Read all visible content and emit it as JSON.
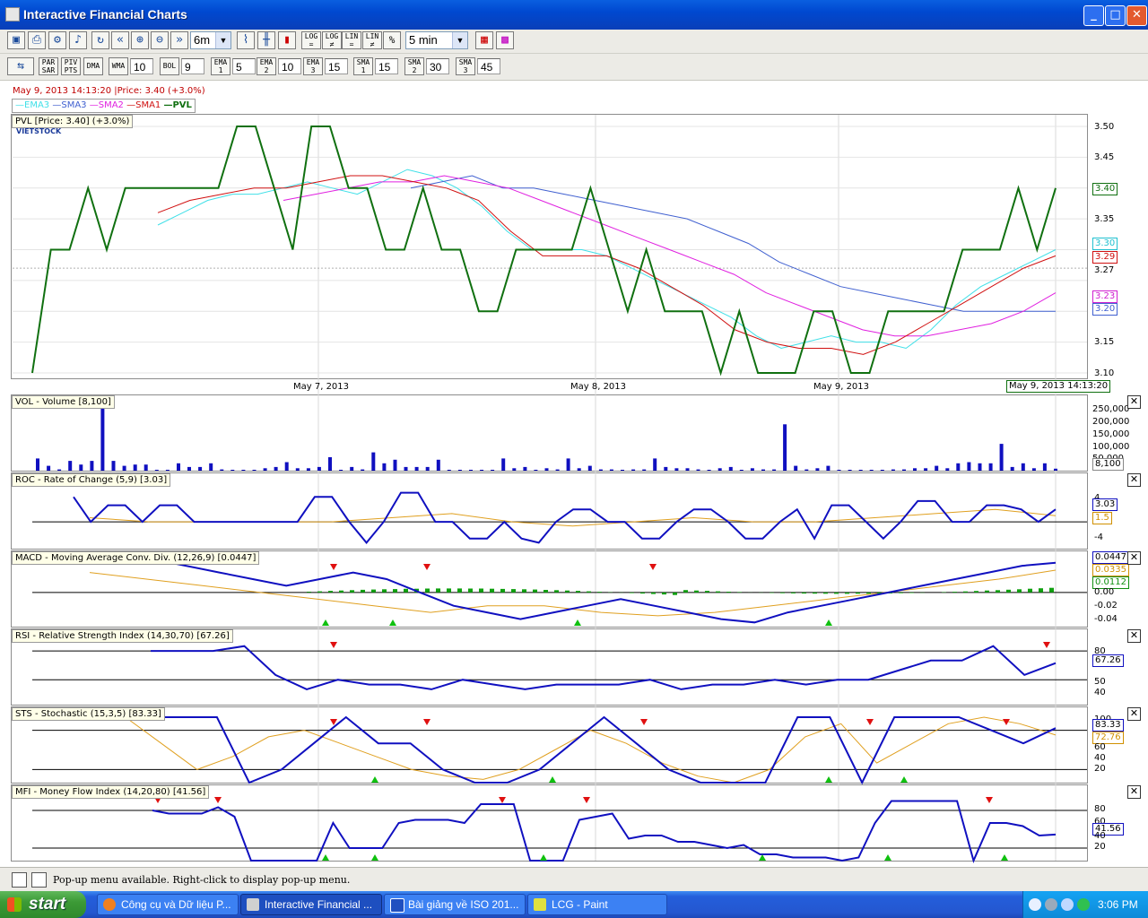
{
  "window": {
    "title": "Interactive Financial Charts"
  },
  "toolbar1": {
    "period_value": "6m",
    "log_buttons": [
      "LOG =",
      "LOG ≠",
      "LIN =",
      "LIN ≠",
      "%"
    ],
    "interval_value": "5 min"
  },
  "toolbar2": {
    "buttons": [
      "PAR SAR",
      "PIV PTS",
      "DMA"
    ],
    "wma_label": "WMA",
    "wma_value": "10",
    "bol_label": "BOL",
    "bol_value": "9",
    "ema1_label": "EMA 1",
    "ema1_value": "5",
    "ema2_label": "EMA 2",
    "ema2_value": "10",
    "ema3_label": "EMA 3",
    "ema3_value": "15",
    "sma1_label": "SMA 1",
    "sma1_value": "15",
    "sma2_label": "SMA 2",
    "sma2_value": "30",
    "sma3_label": "SMA 3",
    "sma3_value": "45"
  },
  "chart_header": {
    "status": "May 9, 2013 14:13:20 |Price: 3.40 (+3.0%)",
    "legend": [
      {
        "label": "EMA3",
        "color": "#40e0e8"
      },
      {
        "label": "SMA3",
        "color": "#4060d0"
      },
      {
        "label": "SMA2",
        "color": "#e020e0"
      },
      {
        "label": "SMA1",
        "color": "#d01010"
      },
      {
        "label": "PVL",
        "color": "#107010"
      }
    ]
  },
  "price_panel": {
    "label": "PVL [Price: 3.40] (+3.0%)",
    "logo_text": "VIETSTOCK",
    "date_labels": [
      "May 7, 2013",
      "May 8, 2013",
      "May 9, 2013"
    ],
    "cursor_date": "May 9, 2013 14:13:20",
    "y_ticks": [
      "3.50",
      "3.45",
      "3.40",
      "3.35",
      "3.30",
      "3.29",
      "3.27",
      "3.23",
      "3.20",
      "3.15",
      "3.10"
    ],
    "value_boxes": [
      {
        "text": "3.40",
        "color": "#107010"
      },
      {
        "text": "3.30",
        "color": "#20c0d0"
      },
      {
        "text": "3.29",
        "color": "#d01010"
      },
      {
        "text": "3.23",
        "color": "#d020d0"
      },
      {
        "text": "3.20",
        "color": "#4060d0"
      }
    ]
  },
  "volume_panel": {
    "label": "VOL - Volume [8,100]",
    "y_ticks": [
      "250,000",
      "200,000",
      "150,000",
      "100,000",
      "50,000"
    ],
    "current": "8,100"
  },
  "roc_panel": {
    "label": "ROC - Rate of Change (5,9) [3.03]",
    "y_ticks": [
      "4",
      "-4"
    ],
    "current": "3.03",
    "signal": "1.5"
  },
  "macd_panel": {
    "label": "MACD - Moving Average Conv. Div. (12,26,9) [0.0447]",
    "y_ticks": [
      "0.00",
      "-0.02",
      "-0.04"
    ],
    "current": "0.0447",
    "signal": "0.0335",
    "hist": "0.0112"
  },
  "rsi_panel": {
    "label": "RSI - Relative Strength Index (14,30,70) [67.26]",
    "y_ticks": [
      "80",
      "50",
      "40"
    ],
    "current": "67.26"
  },
  "sts_panel": {
    "label": "STS - Stochastic (15,3,5) [83.33]",
    "y_ticks": [
      "100",
      "60",
      "40",
      "20"
    ],
    "current": "83.33",
    "signal": "72.76"
  },
  "mfi_panel": {
    "label": "MFI - Money Flow Index (14,20,80) [41.56]",
    "y_ticks": [
      "80",
      "60",
      "40",
      "20"
    ],
    "current": "41.56"
  },
  "statusbar": {
    "message": "Pop-up menu available. Right-click to display pop-up menu."
  },
  "taskbar": {
    "start": "start",
    "tasks": [
      {
        "label": "Công cụ và Dữ liệu P...",
        "color": "#f08020"
      },
      {
        "label": "Interactive Financial ...",
        "color": "#d0d0d0"
      },
      {
        "label": "Bài giảng về ISO 201...",
        "color": "#2050c0"
      },
      {
        "label": "LCG - Paint",
        "color": "#e0e040"
      }
    ],
    "clock": "3:06 PM"
  },
  "chart_data": [
    {
      "type": "line",
      "title": "PVL [Price: 3.40] (+3.0%)",
      "ylim": [
        3.1,
        3.5
      ],
      "x": [
        "May 7, 2013",
        "May 8, 2013",
        "May 9, 2013"
      ],
      "series": [
        {
          "name": "PVL",
          "values": [
            3.1,
            3.3,
            3.3,
            3.4,
            3.3,
            3.4,
            3.4,
            3.4,
            3.4,
            3.4,
            3.4,
            3.5,
            3.5,
            3.4,
            3.3,
            3.5,
            3.5,
            3.4,
            3.4,
            3.3,
            3.3,
            3.4,
            3.3,
            3.3,
            3.2,
            3.2,
            3.3,
            3.3,
            3.3,
            3.3,
            3.4,
            3.3,
            3.2,
            3.3,
            3.2,
            3.2,
            3.2,
            3.1,
            3.2,
            3.1,
            3.1,
            3.1,
            3.2,
            3.2,
            3.1,
            3.1,
            3.2,
            3.2,
            3.2,
            3.2,
            3.3,
            3.3,
            3.3,
            3.4,
            3.3,
            3.4
          ]
        },
        {
          "name": "EMA3",
          "values": [
            3.34,
            3.36,
            3.38,
            3.39,
            3.39,
            3.4,
            3.41,
            3.4,
            3.39,
            3.41,
            3.43,
            3.42,
            3.4,
            3.37,
            3.33,
            3.3,
            3.3,
            3.3,
            3.29,
            3.27,
            3.25,
            3.23,
            3.21,
            3.19,
            3.16,
            3.14,
            3.15,
            3.16,
            3.15,
            3.15,
            3.14,
            3.17,
            3.21,
            3.24,
            3.26,
            3.28,
            3.3
          ]
        },
        {
          "name": "SMA3",
          "values": [
            3.4,
            3.41,
            3.42,
            3.4,
            3.4,
            3.39,
            3.38,
            3.37,
            3.36,
            3.35,
            3.33,
            3.31,
            3.28,
            3.26,
            3.24,
            3.23,
            3.22,
            3.21,
            3.2,
            3.2,
            3.2,
            3.2
          ]
        },
        {
          "name": "SMA2",
          "values": [
            3.38,
            3.39,
            3.4,
            3.41,
            3.41,
            3.42,
            3.41,
            3.4,
            3.38,
            3.36,
            3.34,
            3.32,
            3.3,
            3.28,
            3.26,
            3.23,
            3.21,
            3.19,
            3.17,
            3.16,
            3.16,
            3.17,
            3.18,
            3.2,
            3.23
          ]
        },
        {
          "name": "SMA1",
          "values": [
            3.36,
            3.38,
            3.39,
            3.4,
            3.4,
            3.41,
            3.42,
            3.42,
            3.41,
            3.4,
            3.38,
            3.33,
            3.29,
            3.29,
            3.29,
            3.27,
            3.24,
            3.21,
            3.17,
            3.15,
            3.14,
            3.14,
            3.13,
            3.15,
            3.18,
            3.21,
            3.24,
            3.27,
            3.29
          ]
        }
      ]
    },
    {
      "type": "bar",
      "title": "VOL - Volume [8,100]",
      "ylim": [
        0,
        250000
      ],
      "series": [
        {
          "name": "Volume",
          "values": [
            50000,
            20000,
            5000,
            40000,
            25000,
            40000,
            260000,
            40000,
            20000,
            25000,
            25000,
            3000,
            3000,
            30000,
            15000,
            15000,
            30000,
            5000,
            3000,
            3000,
            3000,
            10000,
            15000,
            35000,
            10000,
            10000,
            15000,
            55000,
            3000,
            15000,
            5000,
            75000,
            30000,
            45000,
            15000,
            15000,
            15000,
            45000,
            3000,
            3000,
            3000,
            3000,
            3000,
            50000,
            10000,
            15000,
            3000,
            10000,
            5000,
            50000,
            10000,
            20000,
            5000,
            5000,
            3000,
            5000,
            5000,
            50000,
            15000,
            10000,
            10000,
            5000,
            3000,
            10000,
            15000,
            3000,
            10000,
            5000,
            5000,
            190000,
            20000,
            5000,
            10000,
            20000,
            3000,
            3000,
            3000,
            3000,
            3000,
            5000,
            5000,
            10000,
            10000,
            20000,
            10000,
            30000,
            35000,
            30000,
            30000,
            110000,
            15000,
            30000,
            10000,
            30000,
            8100
          ]
        }
      ]
    },
    {
      "type": "line",
      "title": "ROC - Rate of Change (5,9) [3.03]",
      "series": [
        {
          "name": "ROC",
          "values": [
            6,
            0,
            4,
            4,
            0,
            4,
            4,
            0,
            0,
            0,
            0,
            0,
            0,
            0,
            6,
            6,
            0,
            -5,
            0,
            7,
            7,
            0,
            0,
            -4,
            -4,
            0,
            -4,
            -5,
            0,
            3,
            3,
            0,
            0,
            -4,
            -4,
            0,
            3,
            3,
            0,
            -4,
            -4,
            0,
            3,
            -4,
            4,
            4,
            0,
            -4,
            0,
            5,
            5,
            0,
            0,
            4,
            4,
            3,
            0,
            3
          ]
        },
        {
          "name": "Signal",
          "values": [
            1,
            0,
            0,
            0,
            0,
            1,
            2,
            0,
            -1,
            0,
            1,
            0,
            0,
            1,
            2,
            3,
            1.5
          ]
        }
      ]
    },
    {
      "type": "line",
      "title": "MACD - Moving Average Conv. Div. (12,26,9) [0.0447]",
      "series": [
        {
          "name": "MACD",
          "values": [
            0.05,
            0.04,
            0.03,
            0.02,
            0.01,
            0.02,
            0.03,
            0.02,
            0.0,
            -0.02,
            -0.03,
            -0.04,
            -0.03,
            -0.02,
            -0.01,
            -0.02,
            -0.03,
            -0.04,
            -0.045,
            -0.03,
            -0.02,
            -0.01,
            0.0,
            0.01,
            0.02,
            0.03,
            0.04,
            0.0447
          ]
        },
        {
          "name": "Signal",
          "values": [
            0.03,
            0.02,
            0.01,
            0.0,
            -0.01,
            -0.02,
            -0.03,
            -0.02,
            -0.02,
            -0.03,
            -0.035,
            -0.03,
            -0.02,
            -0.01,
            0.0,
            0.01,
            0.02,
            0.0335
          ]
        }
      ]
    },
    {
      "type": "line",
      "title": "RSI - Relative Strength Index (14,30,70) [67.26]",
      "series": [
        {
          "name": "RSI",
          "values": [
            80,
            80,
            80,
            85,
            55,
            40,
            50,
            45,
            45,
            40,
            50,
            45,
            40,
            45,
            45,
            45,
            50,
            40,
            45,
            45,
            50,
            45,
            50,
            50,
            60,
            70,
            70,
            85,
            55,
            67.26
          ]
        }
      ]
    },
    {
      "type": "line",
      "title": "STS - Stochastic (15,3,5) [83.33]",
      "series": [
        {
          "name": "%K",
          "values": [
            100,
            100,
            100,
            0,
            20,
            60,
            100,
            60,
            60,
            20,
            0,
            0,
            20,
            60,
            100,
            60,
            20,
            0,
            0,
            0,
            100,
            100,
            0,
            100,
            100,
            100,
            80,
            60,
            83.33
          ]
        },
        {
          "name": "%D",
          "values": [
            100,
            100,
            60,
            20,
            40,
            70,
            80,
            60,
            40,
            20,
            10,
            5,
            20,
            50,
            80,
            60,
            30,
            10,
            0,
            20,
            70,
            90,
            30,
            60,
            90,
            100,
            90,
            72.76
          ]
        }
      ]
    },
    {
      "type": "line",
      "title": "MFI - Money Flow Index (14,20,80) [41.56]",
      "series": [
        {
          "name": "MFI",
          "values": [
            80,
            75,
            75,
            75,
            85,
            70,
            0,
            0,
            0,
            0,
            0,
            60,
            20,
            20,
            20,
            60,
            65,
            65,
            65,
            60,
            90,
            90,
            90,
            0,
            0,
            0,
            65,
            70,
            75,
            35,
            40,
            40,
            30,
            30,
            25,
            20,
            25,
            10,
            10,
            5,
            5,
            5,
            0,
            5,
            60,
            95,
            95,
            95,
            95,
            95,
            0,
            60,
            60,
            55,
            40,
            41.56
          ]
        }
      ]
    }
  ]
}
